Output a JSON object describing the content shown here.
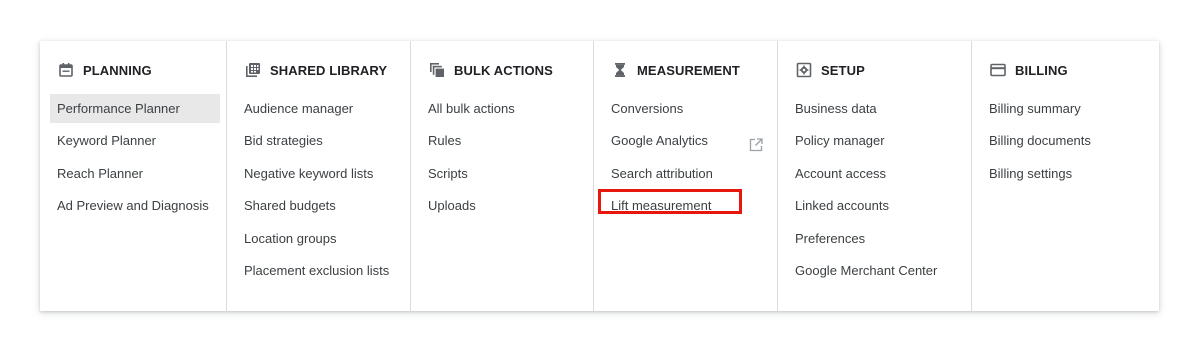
{
  "colors": {
    "highlight_border": "#e8170e",
    "active_item_bg": "#e8e8e8",
    "divider": "#dadce0",
    "icon": "#5f6368"
  },
  "columns": [
    {
      "title": "PLANNING",
      "icon": "calendar-icon",
      "items": [
        {
          "label": "Performance Planner",
          "active": true
        },
        {
          "label": "Keyword Planner"
        },
        {
          "label": "Reach Planner"
        },
        {
          "label": "Ad Preview and Diagnosis"
        }
      ]
    },
    {
      "title": "SHARED LIBRARY",
      "icon": "library-grid-icon",
      "items": [
        {
          "label": "Audience manager"
        },
        {
          "label": "Bid strategies"
        },
        {
          "label": "Negative keyword lists"
        },
        {
          "label": "Shared budgets"
        },
        {
          "label": "Location groups"
        },
        {
          "label": "Placement exclusion lists"
        }
      ]
    },
    {
      "title": "BULK ACTIONS",
      "icon": "bulk-copy-icon",
      "items": [
        {
          "label": "All bulk actions"
        },
        {
          "label": "Rules"
        },
        {
          "label": "Scripts"
        },
        {
          "label": "Uploads"
        }
      ]
    },
    {
      "title": "MEASUREMENT",
      "icon": "hourglass-icon",
      "items": [
        {
          "label": "Conversions"
        },
        {
          "label": "Google Analytics",
          "external": true,
          "external_icon": "open-in-new-icon"
        },
        {
          "label": "Search attribution"
        },
        {
          "label": "Lift measurement",
          "highlighted": true
        }
      ]
    },
    {
      "title": "SETUP",
      "icon": "settings-box-icon",
      "items": [
        {
          "label": "Business data"
        },
        {
          "label": "Policy manager"
        },
        {
          "label": "Account access"
        },
        {
          "label": "Linked accounts"
        },
        {
          "label": "Preferences"
        },
        {
          "label": "Google Merchant Center"
        }
      ]
    },
    {
      "title": "BILLING",
      "icon": "credit-card-icon",
      "items": [
        {
          "label": "Billing summary"
        },
        {
          "label": "Billing documents"
        },
        {
          "label": "Billing settings"
        }
      ]
    }
  ]
}
